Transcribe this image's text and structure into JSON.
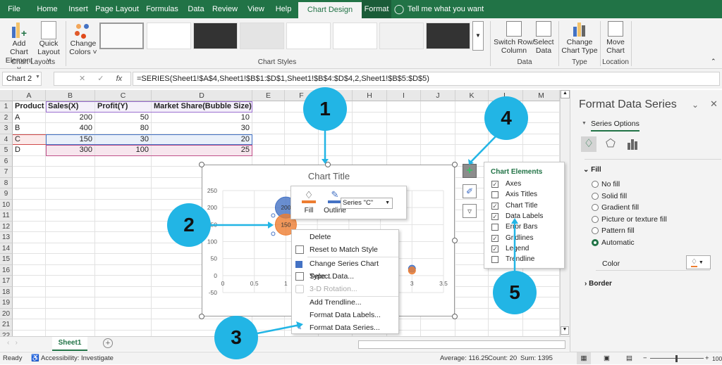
{
  "ribbon_tabs": [
    "File",
    "Home",
    "Insert",
    "Page Layout",
    "Formulas",
    "Data",
    "Review",
    "View",
    "Help",
    "Chart Design",
    "Format"
  ],
  "tell_me": "Tell me what you want to do",
  "ribbon": {
    "add_chart_element": [
      "Add Chart",
      "Element ˅"
    ],
    "quick_layout": [
      "Quick",
      "Layout ˅"
    ],
    "change_colors": [
      "Change",
      "Colors ˅"
    ],
    "switch_row_column": [
      "Switch Row/",
      "Column"
    ],
    "select_data": [
      "Select",
      "Data"
    ],
    "change_chart_type": [
      "Change",
      "Chart Type"
    ],
    "move_chart": [
      "Move",
      "Chart"
    ],
    "groups": {
      "chart_layouts": "Chart Layouts",
      "chart_styles": "Chart Styles",
      "data": "Data",
      "type": "Type",
      "location": "Location"
    }
  },
  "formula_bar": {
    "name_box": "Chart 2",
    "fx": "fx",
    "formula": "=SERIES(Sheet1!$A$4,Sheet1!$B$1:$D$1,Sheet1!$B$4:$D$4,2,Sheet1!$B$5:$D$5)"
  },
  "columns": [
    "A",
    "B",
    "C",
    "D",
    "E",
    "F",
    "G",
    "H",
    "I",
    "J",
    "K",
    "L",
    "M"
  ],
  "rows": [
    "1",
    "2",
    "3",
    "4",
    "5",
    "6",
    "7",
    "8",
    "9",
    "10",
    "11",
    "12",
    "13",
    "14",
    "15",
    "16",
    "17",
    "18",
    "19",
    "20",
    "21",
    "22"
  ],
  "table": {
    "headers": [
      "Product",
      "Sales(X)",
      "Profit(Y)",
      "Market Share(Bubble Size)"
    ],
    "data": [
      [
        "A",
        "200",
        "50",
        "10"
      ],
      [
        "B",
        "400",
        "80",
        "30"
      ],
      [
        "C",
        "150",
        "30",
        "20"
      ],
      [
        "D",
        "300",
        "100",
        "25"
      ]
    ]
  },
  "chart_data": {
    "type": "scatter",
    "title": "Chart Title",
    "xlim": [
      0,
      3.5
    ],
    "ylim": [
      -50,
      250
    ],
    "x_ticks": [
      "0",
      "0.5",
      "1",
      "1.5",
      "2",
      "2.5",
      "3",
      "3.5"
    ],
    "y_ticks": [
      "250",
      "200",
      "150",
      "100",
      "50",
      "0",
      "-50"
    ],
    "grid": true,
    "bubbles": [
      {
        "x": 1,
        "y": 200,
        "label": "200",
        "color": "#4472c4"
      },
      {
        "x": 1,
        "y": 150,
        "label": "150",
        "color": "#ed7d31"
      },
      {
        "x": 3,
        "y": 20,
        "label": "",
        "color": "#4472c4"
      },
      {
        "x": 3,
        "y": 15,
        "label": "",
        "color": "#ed7d31"
      }
    ]
  },
  "mini_toolbar": {
    "fill": "Fill",
    "outline": "Outline",
    "series_select": "Series \"C\""
  },
  "context_menu": [
    "Delete",
    "Reset to Match Style",
    "Change Series Chart Type...",
    "Select Data...",
    "3-D Rotation...",
    "Add Trendline...",
    "Format Data Labels...",
    "Format Data Series..."
  ],
  "chart_elements": {
    "title": "Chart Elements",
    "items": [
      {
        "label": "Axes",
        "checked": true
      },
      {
        "label": "Axis Titles",
        "checked": false
      },
      {
        "label": "Chart Title",
        "checked": true
      },
      {
        "label": "Data Labels",
        "checked": true
      },
      {
        "label": "Error Bars",
        "checked": false
      },
      {
        "label": "Gridlines",
        "checked": true
      },
      {
        "label": "Legend",
        "checked": true
      },
      {
        "label": "Trendline",
        "checked": false
      }
    ]
  },
  "callouts": [
    "1",
    "2",
    "3",
    "4",
    "5"
  ],
  "panel": {
    "title": "Format Data Series",
    "tab": "Series Options",
    "fill_section": "Fill",
    "options": [
      "No fill",
      "Solid fill",
      "Gradient fill",
      "Picture or texture fill",
      "Pattern fill",
      "Automatic"
    ],
    "selected": "Automatic",
    "color_label": "Color",
    "border_section": "Border"
  },
  "sheet_tab": "Sheet1",
  "status": {
    "ready": "Ready",
    "accessibility": "Accessibility: Investigate",
    "average": "Average: 116.25",
    "count": "Count: 20",
    "sum": "Sum: 1395",
    "zoom": "100%"
  },
  "colors": {
    "excel_green": "#217346",
    "callout": "#22b5e5",
    "blue_series": "#4472c4",
    "orange_series": "#ed7d31"
  }
}
